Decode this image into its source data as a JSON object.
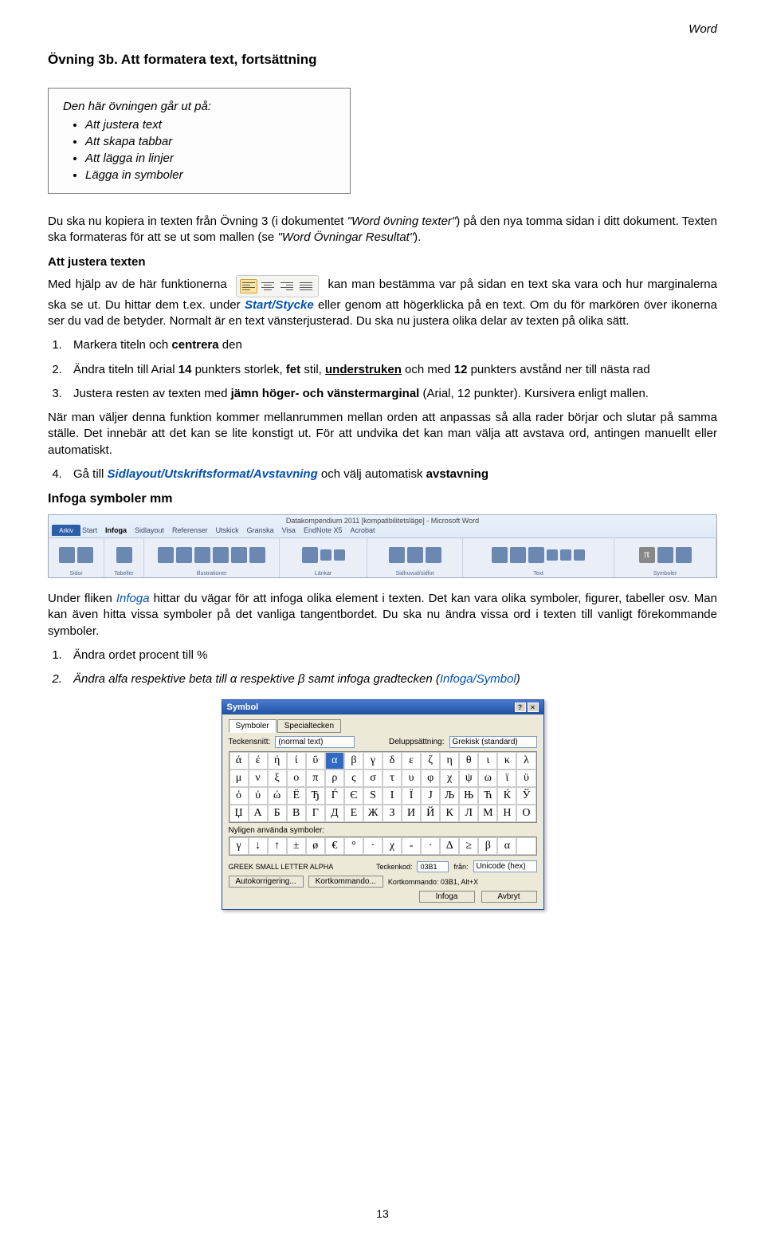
{
  "header": {
    "label": "Word"
  },
  "title": "Övning 3b. Att formatera text, fortsättning",
  "infobox": {
    "lead": "Den här övningen går ut på:",
    "items": [
      "Att justera text",
      "Att skapa tabbar",
      "Att lägga in linjer",
      "Lägga in symboler"
    ]
  },
  "para1_a": "Du ska nu kopiera in texten från Övning 3 (i dokumentet ",
  "para1_b": "\"Word övning texter\"",
  "para1_c": ") på den nya tomma sidan i ditt dokument. Texten ska formateras för att se ut som mallen (se ",
  "para1_d": "\"Word Övningar Resultat\"",
  "para1_e": ").",
  "h_justera": "Att justera texten",
  "para2_a": "Med hjälp av de här funktionerna ",
  "para2_b": " kan man bestämma var på sidan en text ska vara och hur marginalerna ska se ut. Du hittar dem t.ex. under ",
  "para2_c": "Start/Stycke",
  "para2_d": " eller genom att högerklicka på en text. Om du för markören över ikonerna ser du vad de betyder. Normalt är en text vänsterjusterad. Du ska nu justera olika delar av texten på olika sätt.",
  "list1": {
    "i1_a": "Markera titeln och ",
    "i1_b": "centrera",
    "i1_c": " den",
    "i2_a": "Ändra titeln till Arial ",
    "i2_b": "14",
    "i2_c": " punkters storlek, ",
    "i2_d": "fet",
    "i2_e": " stil, ",
    "i2_f": "understruken",
    "i2_g": " och med ",
    "i2_h": "12",
    "i2_i": " punkters avstånd ner till nästa rad",
    "i3_a": "Justera resten av texten med ",
    "i3_b": "jämn höger- och vänstermarginal",
    "i3_c": " (Arial, 12 punkter). Kursivera enligt mallen."
  },
  "para3": "När man väljer denna funktion kommer mellanrummen mellan orden att anpassas så alla rader börjar och slutar på samma ställe. Det innebär att det kan se lite konstigt ut. För att undvika det kan man välja att avstava ord, antingen manuellt eller automatiskt.",
  "list2": {
    "i4_a": "Gå till ",
    "i4_b": "Sidlayout/Utskriftsformat/Avstavning",
    "i4_c": " och välj automatisk ",
    "i4_d": "avstavning"
  },
  "h_infoga": "Infoga symboler mm",
  "ribbon": {
    "doc_title": "Datakompendium 2011 [kompatibilitetsläge] - Microsoft Word",
    "file": "Arkiv",
    "tabs": [
      "Start",
      "Infoga",
      "Sidlayout",
      "Referenser",
      "Utskick",
      "Granska",
      "Visa",
      "EndNote X5",
      "Acrobat"
    ],
    "groups": [
      "Sidor",
      "Tabeller",
      "Illustrationer",
      "Länkar",
      "Sidhuvud/sidfot",
      "Text",
      "Symboler"
    ]
  },
  "para4_a": "Under fliken ",
  "para4_b": "Infoga",
  "para4_c": " hittar du vägar för att infoga olika element i texten. Det kan vara olika symboler, figurer, tabeller osv. Man kan även hitta vissa symboler på det vanliga tangentbordet. Du ska nu ändra vissa ord i texten till vanligt förekommande symboler.",
  "list3": {
    "i1": "Ändra ordet procent till %",
    "i2_a": "Ändra alfa respektive beta till α respektive β samt infoga gradtecken (",
    "i2_b": "Infoga/Symbol",
    "i2_c": ")"
  },
  "dialog": {
    "title": "Symbol",
    "tabs": [
      "Symboler",
      "Specialtecken"
    ],
    "font_label": "Teckensnitt:",
    "font_value": "(normal text)",
    "subset_label": "Deluppsättning:",
    "subset_value": "Grekisk (standard)",
    "recent_label": "Nyligen använda symboler:",
    "charname": "GREEK SMALL LETTER ALPHA",
    "code_label": "Teckenkod:",
    "code_value": "03B1",
    "from_label": "från:",
    "from_value": "Unicode (hex)",
    "auto_btn": "Autokorrigering...",
    "short_btn": "Kortkommando...",
    "short_info": "Kortkommando: 03B1, Alt+X",
    "insert_btn": "Infoga",
    "cancel_btn": "Avbryt"
  },
  "chart_data": {
    "type": "table",
    "title": "Symbol grid",
    "rows": [
      [
        "ά",
        "έ",
        "ή",
        "ί",
        "ΰ",
        "α",
        "β",
        "γ",
        "δ",
        "ε",
        "ζ",
        "η",
        "θ",
        "ι",
        "κ",
        "λ"
      ],
      [
        "μ",
        "ν",
        "ξ",
        "ο",
        "π",
        "ρ",
        "ς",
        "σ",
        "τ",
        "υ",
        "φ",
        "χ",
        "ψ",
        "ω",
        "ϊ",
        "ϋ"
      ],
      [
        "ό",
        "ύ",
        "ώ",
        "Ё",
        "Ђ",
        "Ѓ",
        "Є",
        "Ѕ",
        "І",
        "Ї",
        "Ј",
        "Љ",
        "Њ",
        "Ћ",
        "Ќ",
        "Ў"
      ],
      [
        "Џ",
        "А",
        "Б",
        "В",
        "Г",
        "Д",
        "Е",
        "Ж",
        "З",
        "И",
        "Й",
        "К",
        "Л",
        "М",
        "Н",
        "О"
      ]
    ],
    "selected": [
      0,
      5
    ],
    "recent": [
      "γ",
      "↓",
      "↑",
      "±",
      "ø",
      "€",
      "°",
      "·",
      "χ",
      "-",
      "·",
      "Δ",
      "≥",
      "β",
      "α",
      ""
    ]
  },
  "page_number": "13"
}
